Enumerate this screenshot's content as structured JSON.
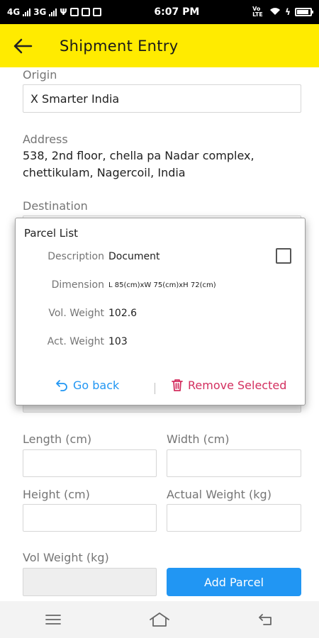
{
  "status_bar": {
    "network1": "4G",
    "network2": "3G",
    "time": "6:07 PM",
    "volte": "Vo LTE"
  },
  "app_bar": {
    "title": "Shipment Entry",
    "back_icon": "arrow-left-icon"
  },
  "form": {
    "origin_label": "Origin",
    "origin_value": "X Smarter India",
    "address_label": "Address",
    "address_value": "538, 2nd floor, chella pa Nadar complex, chettikulam, Nagercoil, India",
    "destination_label": "Destination",
    "length_label": "Length (cm)",
    "width_label": "Width (cm)",
    "height_label": "Height (cm)",
    "actual_weight_label": "Actual Weight (kg)",
    "vol_weight_label": "Vol Weight (kg)",
    "add_parcel_label": "Add Parcel"
  },
  "dialog": {
    "title": "Parcel List",
    "rows": [
      {
        "label": "Description",
        "value": "Document"
      },
      {
        "label": "Dimension",
        "value": "L 85(cm)xW 75(cm)xH 72(cm)"
      },
      {
        "label": "Vol. Weight",
        "value": "102.6"
      },
      {
        "label": "Act. Weight",
        "value": "103"
      }
    ],
    "checkbox_checked": false,
    "go_back_label": "Go back",
    "remove_selected_label": "Remove Selected",
    "go_back_color": "#2196F3",
    "remove_color": "#D32F5F"
  },
  "colors": {
    "app_bar": "#FFEB00",
    "primary_button": "#2196F3"
  }
}
